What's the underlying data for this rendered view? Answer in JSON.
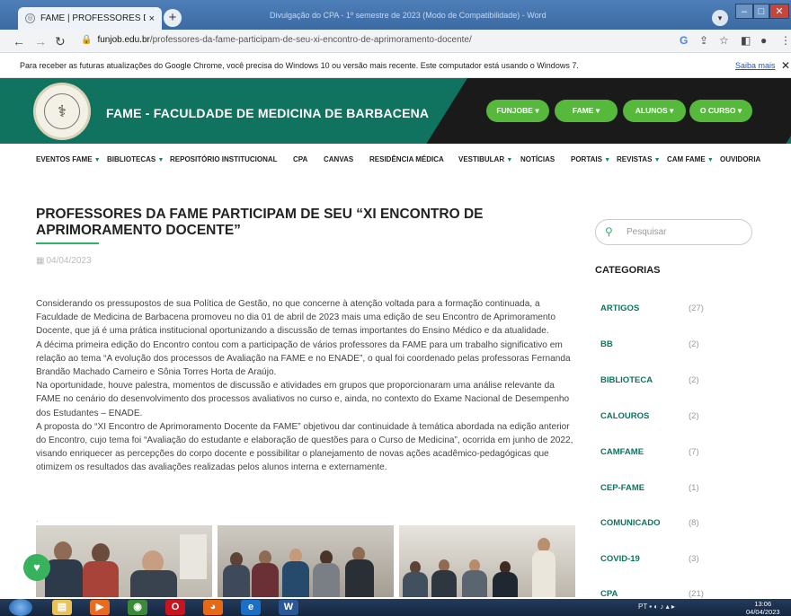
{
  "browser": {
    "tab_title": "FAME | PROFESSORES DA FAME",
    "tab_close": "×",
    "new_tab": "+",
    "window_title": "Divulgação do CPA - 1º semestre de 2023 (Modo de Compatibilidade) - Word",
    "url_host": "funjob.edu.br",
    "url_path": "/professores-da-fame-participam-de-seu-xi-encontro-de-aprimoramento-docente/",
    "infobar_message": "Para receber as futuras atualizações do Google Chrome, você precisa do Windows 10 ou versão mais recente. Este computador está usando o Windows 7.",
    "infobar_link": "Saiba mais",
    "infobar_close": "✕"
  },
  "site": {
    "name": "FAME - FACULDADE DE MEDICINA DE BARBACENA",
    "pills": [
      "FUNJOBE",
      "FAME",
      "ALUNOS",
      "O CURSO"
    ],
    "menu": [
      {
        "label": "EVENTOS FAME",
        "caret": "▼"
      },
      {
        "label": "BIBLIOTECAS",
        "caret": "▼"
      },
      {
        "label": "REPOSITÓRIO INSTITUCIONAL",
        "caret": ""
      },
      {
        "label": "CPA",
        "caret": ""
      },
      {
        "label": "CANVAS",
        "caret": ""
      },
      {
        "label": "RESIDÊNCIA MÉDICA",
        "caret": ""
      },
      {
        "label": "VESTIBULAR",
        "caret": "▼"
      },
      {
        "label": "NOTÍCIAS",
        "caret": ""
      },
      {
        "label": "PORTAIS",
        "caret": "▼"
      },
      {
        "label": "REVISTAS",
        "caret": "▼"
      },
      {
        "label": "CAM FAME",
        "caret": "▼"
      },
      {
        "label": "OUVIDORIA",
        "caret": ""
      }
    ]
  },
  "article": {
    "title": "PROFESSORES DA FAME PARTICIPAM DE SEU “XI ENCONTRO DE APRIMORAMENTO DOCENTE”",
    "date": "04/04/2023",
    "paragraphs": [
      "Considerando os pressupostos de sua Política de Gestão, no que concerne à atenção voltada para a formação continuada, a Faculdade de Medicina de Barbacena promoveu no dia 01 de abril de 2023 mais uma edição de seu Encontro de Aprimoramento Docente, que já é uma prática institucional oportunizando a discussão de temas importantes do Ensino Médico e da atualidade.",
      "A décima primeira edição do Encontro contou com a participação de vários professores da FAME para um trabalho significativo em relação ao tema “A evolução dos processos de Avaliação na FAME e no ENADE”, o qual foi coordenado pelas professoras Fernanda Brandão Machado Carneiro e Sônia Torres Horta de Araújo.",
      "Na oportunidade, houve palestra, momentos de discussão e atividades em grupos que proporcionaram uma análise relevante da FAME no cenário do desenvolvimento dos processos avaliativos no curso e, ainda, no contexto do Exame Nacional de Desempenho dos Estudantes – ENADE.",
      "A proposta do “XI Encontro de Aprimoramento Docente da FAME” objetivou dar continuidade à temática abordada na edição anterior do Encontro, cujo tema foi “Avaliação do estudante e elaboração de questões para o Curso de Medicina”, ocorrida em junho de 2022, visando enriquecer as percepções do corpo docente e possibilitar o planejamento de novas ações acadêmico-pedagógicas que otimizem os resultados das avaliações realizadas pelos alunos interna e externamente."
    ],
    "trailing_dot": "."
  },
  "sidebar": {
    "search_placeholder": "Pesquisar",
    "categories_title": "CATEGORIAS",
    "categories": [
      {
        "name": "ARTIGOS",
        "count": "(27)"
      },
      {
        "name": "BB",
        "count": "(2)"
      },
      {
        "name": "BIBLIOTECA",
        "count": "(2)"
      },
      {
        "name": "CALOUROS",
        "count": "(2)"
      },
      {
        "name": "CAMFAME",
        "count": "(7)"
      },
      {
        "name": "CEP-FAME",
        "count": "(1)"
      },
      {
        "name": "COMUNICADO",
        "count": "(8)"
      },
      {
        "name": "COVID-19",
        "count": "(3)"
      },
      {
        "name": "CPA",
        "count": "(21)"
      }
    ]
  },
  "taskbar": {
    "tray_text": "PT",
    "time": "13:06",
    "date": "04/04/2023"
  },
  "colors": {
    "brand_green": "#0f735f",
    "pill_green": "#57b93b",
    "accent": "#2fb26a"
  }
}
